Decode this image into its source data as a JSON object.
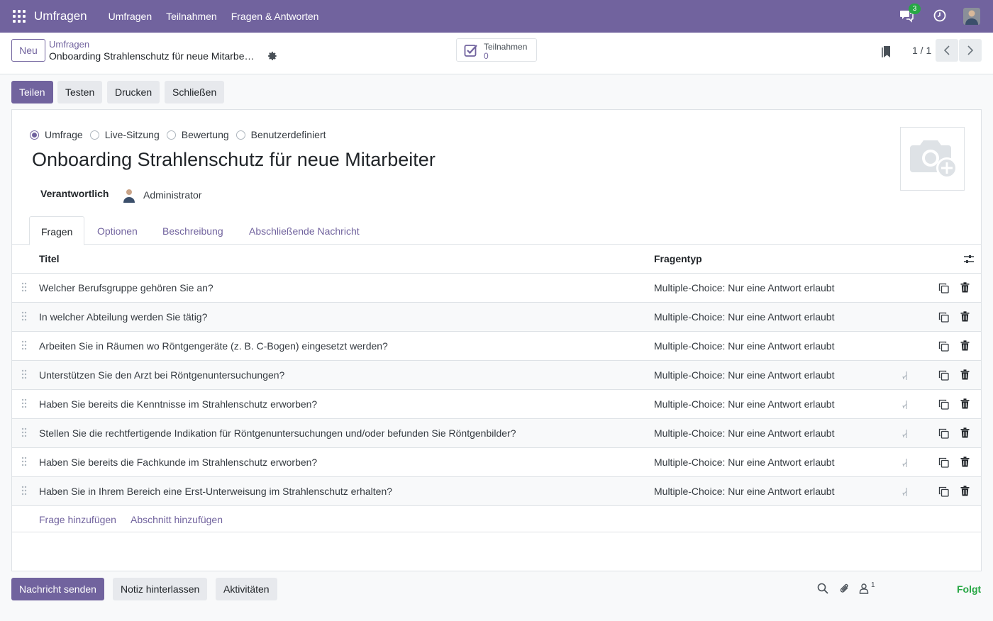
{
  "navbar": {
    "brand": "Umfragen",
    "menu": [
      "Umfragen",
      "Teilnahmen",
      "Fragen & Antworten"
    ],
    "chat_badge": "3",
    "color": "#71639e"
  },
  "control_panel": {
    "new_button": "Neu",
    "breadcrumb_parent": "Umfragen",
    "breadcrumb_current": "Onboarding Strahlenschutz für neue Mitarbe…",
    "stat_label": "Teilnahmen",
    "stat_value": "0",
    "pager": "1 / 1"
  },
  "actions": [
    "Teilen",
    "Testen",
    "Drucken",
    "Schließen"
  ],
  "form": {
    "survey_types": [
      "Umfrage",
      "Live-Sitzung",
      "Bewertung",
      "Benutzerdefiniert"
    ],
    "selected_type": "Umfrage",
    "title": "Onboarding Strahlenschutz für neue Mitarbeiter",
    "responsible_label": "Verantwortlich",
    "responsible_value": "Administrator"
  },
  "tabs": [
    "Fragen",
    "Optionen",
    "Beschreibung",
    "Abschließende Nachricht"
  ],
  "active_tab": "Fragen",
  "table": {
    "columns": [
      "Titel",
      "Fragentyp"
    ],
    "rows": [
      {
        "title": "Welcher Berufsgruppe gehören Sie an?",
        "type": "Multiple-Choice: Nur eine Antwort erlaubt",
        "conditional": false
      },
      {
        "title": "In welcher Abteilung werden Sie tätig?",
        "type": "Multiple-Choice: Nur eine Antwort erlaubt",
        "conditional": false
      },
      {
        "title": "Arbeiten Sie in Räumen wo Röntgengeräte (z. B. C-Bogen) eingesetzt werden?",
        "type": "Multiple-Choice: Nur eine Antwort erlaubt",
        "conditional": false
      },
      {
        "title": "Unterstützen Sie den Arzt bei Röntgenuntersuchungen?",
        "type": "Multiple-Choice: Nur eine Antwort erlaubt",
        "conditional": true
      },
      {
        "title": "Haben Sie bereits die Kenntnisse im Strahlenschutz erworben?",
        "type": "Multiple-Choice: Nur eine Antwort erlaubt",
        "conditional": true
      },
      {
        "title": "Stellen Sie die rechtfertigende Indikation für Röntgenuntersuchungen und/oder befunden Sie Röntgenbilder?",
        "type": "Multiple-Choice: Nur eine Antwort erlaubt",
        "conditional": true
      },
      {
        "title": "Haben Sie bereits die Fachkunde im Strahlenschutz erworben?",
        "type": "Multiple-Choice: Nur eine Antwort erlaubt",
        "conditional": true
      },
      {
        "title": "Haben Sie in Ihrem Bereich eine Erst-Unterweisung im Strahlenschutz erhalten?",
        "type": "Multiple-Choice: Nur eine Antwort erlaubt",
        "conditional": true
      }
    ],
    "add_question": "Frage hinzufügen",
    "add_section": "Abschnitt hinzufügen"
  },
  "chatter": {
    "send_message": "Nachricht senden",
    "log_note": "Notiz hinterlassen",
    "activities": "Aktivitäten",
    "followers_count": "1",
    "follow_state": "Folgt"
  }
}
